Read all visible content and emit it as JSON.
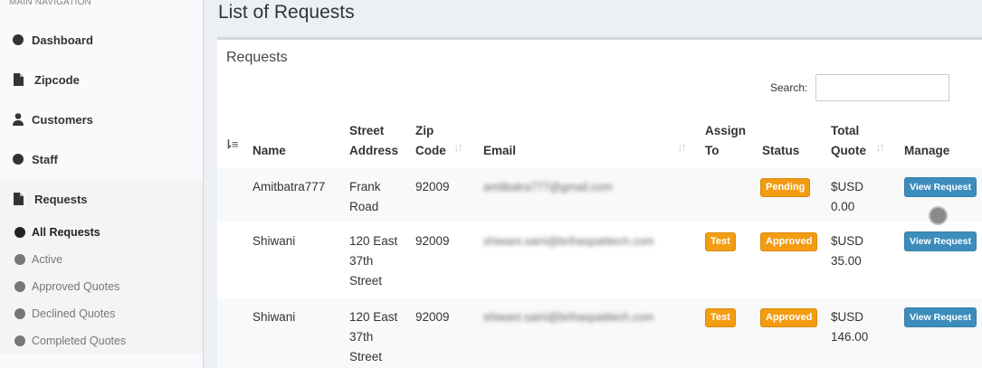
{
  "sidebar": {
    "header": "MAIN NAVIGATION",
    "items": [
      {
        "label": "Dashboard",
        "icon": "circle-icon"
      },
      {
        "label": "Zipcode",
        "icon": "file-icon"
      },
      {
        "label": "Customers",
        "icon": "user-icon"
      },
      {
        "label": "Staff",
        "icon": "circle-icon"
      },
      {
        "label": "Requests",
        "icon": "file-icon"
      }
    ],
    "subitems": [
      {
        "label": "All Requests"
      },
      {
        "label": "Active"
      },
      {
        "label": "Approved Quotes"
      },
      {
        "label": "Declined Quotes"
      },
      {
        "label": "Completed Quotes"
      }
    ]
  },
  "page": {
    "title": "List of Requests"
  },
  "box": {
    "title": "Requests",
    "search_label": "Search:",
    "search_value": ""
  },
  "table": {
    "headers": {
      "name": "Name",
      "street1": "Street",
      "street2": "Address",
      "zip1": "Zip",
      "zip2": "Code",
      "email": "Email",
      "assign1": "Assign",
      "assign2": "To",
      "status": "Status",
      "total1": "Total",
      "total2": "Quote",
      "manage": "Manage"
    },
    "rows": [
      {
        "name": "Amitbatra777",
        "street": [
          "Frank",
          "Road"
        ],
        "zip": "92009",
        "email": "amitbatra777@gmail.com",
        "assign": "",
        "status": "Pending",
        "total": [
          "$USD",
          "0.00"
        ],
        "action": "View Request"
      },
      {
        "name": "Shiwani",
        "street": [
          "120 East",
          "37th",
          "Street"
        ],
        "zip": "92009",
        "email": "shiwani.saini@brihaspatitech.com",
        "assign": "Test",
        "status": "Approved",
        "total": [
          "$USD",
          "35.00"
        ],
        "action": "View Request"
      },
      {
        "name": "Shiwani",
        "street": [
          "120 East",
          "37th",
          "Street"
        ],
        "zip": "92009",
        "email": "shiwani.saini@brihaspatitech.com",
        "assign": "Test",
        "status": "Approved",
        "total": [
          "$USD",
          "146.00"
        ],
        "action": "View Request"
      }
    ]
  },
  "colors": {
    "primary": "#3c8dbc",
    "warning": "#f39c12",
    "sidebar_bg": "#f9fafc"
  }
}
